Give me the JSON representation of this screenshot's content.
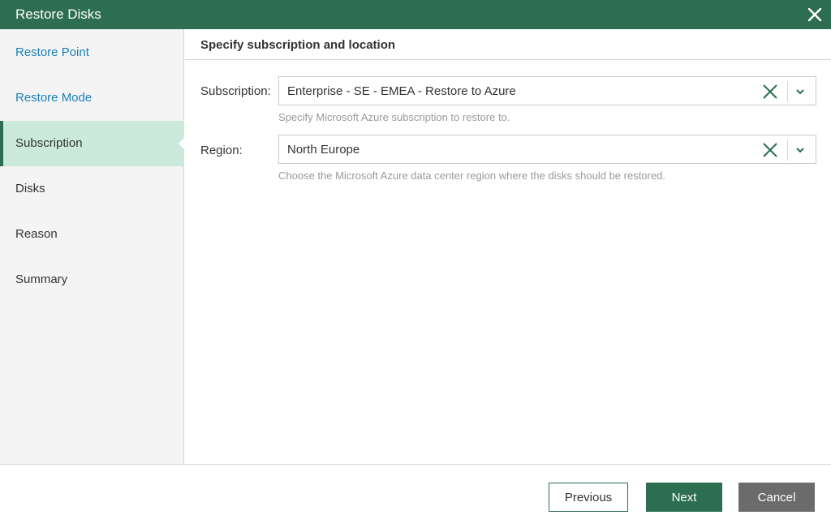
{
  "window": {
    "title": "Restore Disks",
    "close_icon": "close-icon",
    "accent_color": "#2c6e4f"
  },
  "sidebar": {
    "items": [
      {
        "label": "Restore Point",
        "state": "completed"
      },
      {
        "label": "Restore Mode",
        "state": "completed"
      },
      {
        "label": "Subscription",
        "state": "active"
      },
      {
        "label": "Disks",
        "state": "pending"
      },
      {
        "label": "Reason",
        "state": "pending"
      },
      {
        "label": "Summary",
        "state": "pending"
      }
    ]
  },
  "main": {
    "section_title": "Specify subscription and location",
    "subscription": {
      "label": "Subscription:",
      "value": "Enterprise - SE - EMEA - Restore to Azure",
      "hint": "Specify Microsoft Azure subscription to restore to."
    },
    "region": {
      "label": "Region:",
      "value": "North Europe",
      "hint": "Choose the Microsoft Azure data center region where the disks should be restored."
    }
  },
  "footer": {
    "previous_label": "Previous",
    "next_label": "Next",
    "cancel_label": "Cancel"
  }
}
